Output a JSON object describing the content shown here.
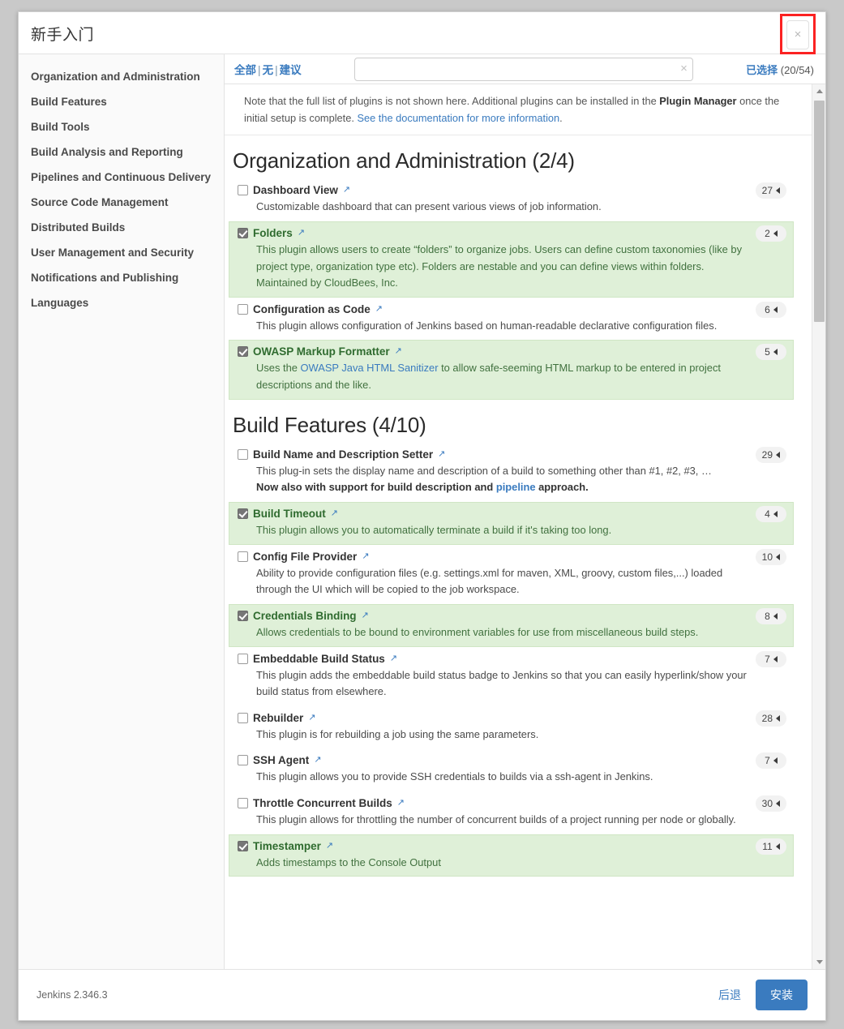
{
  "window": {
    "title": "新手入门",
    "close_label": "×"
  },
  "sidebar": {
    "items": [
      {
        "label": "Organization and Administration"
      },
      {
        "label": "Build Features"
      },
      {
        "label": "Build Tools"
      },
      {
        "label": "Build Analysis and Reporting"
      },
      {
        "label": "Pipelines and Continuous Delivery"
      },
      {
        "label": "Source Code Management"
      },
      {
        "label": "Distributed Builds"
      },
      {
        "label": "User Management and Security"
      },
      {
        "label": "Notifications and Publishing"
      },
      {
        "label": "Languages"
      }
    ]
  },
  "toolbar": {
    "filter_all": "全部",
    "filter_none": "无",
    "filter_suggested": "建议",
    "separator": "|",
    "search_value": "",
    "search_placeholder": "",
    "search_clear_icon": "×",
    "selected_label": "已选择",
    "selected_count": "(20/54)"
  },
  "notice": {
    "text_1": "Note that the full list of plugins is not shown here. Additional plugins can be installed in the ",
    "bold": "Plugin Manager",
    "text_2": " once the initial setup is complete. ",
    "link": "See the documentation for more information",
    "text_3": "."
  },
  "sections": [
    {
      "title": "Organization and Administration (2/4)",
      "plugins": [
        {
          "name": "Dashboard View",
          "checked": false,
          "badge": "27",
          "desc": "Customizable dashboard that can present various views of job information."
        },
        {
          "name": "Folders",
          "checked": true,
          "badge": "2",
          "desc": "This plugin allows users to create “folders” to organize jobs. Users can define custom taxonomies (like by project type, organization type etc). Folders are nestable and you can define views within folders. Maintained by CloudBees, Inc."
        },
        {
          "name": "Configuration as Code",
          "checked": false,
          "badge": "6",
          "desc": "This plugin allows configuration of Jenkins based on human-readable declarative configuration files."
        },
        {
          "name": "OWASP Markup Formatter",
          "checked": true,
          "badge": "5",
          "desc_pre": "Uses the ",
          "desc_link": "OWASP Java HTML Sanitizer",
          "desc_post": " to allow safe-seeming HTML markup to be entered in project descriptions and the like."
        }
      ]
    },
    {
      "title": "Build Features (4/10)",
      "plugins": [
        {
          "name": "Build Name and Description Setter",
          "checked": false,
          "badge": "29",
          "desc": "This plug-in sets the display name and description of a build to something other than #1, #2, #3, …",
          "desc_bold_pre": "Now also with support for build description and ",
          "desc_bold_link": "pipeline",
          "desc_bold_post": " approach."
        },
        {
          "name": "Build Timeout",
          "checked": true,
          "badge": "4",
          "desc": "This plugin allows you to automatically terminate a build if it's taking too long."
        },
        {
          "name": "Config File Provider",
          "checked": false,
          "badge": "10",
          "desc": "Ability to provide configuration files (e.g. settings.xml for maven, XML, groovy, custom files,...) loaded through the UI which will be copied to the job workspace."
        },
        {
          "name": "Credentials Binding",
          "checked": true,
          "badge": "8",
          "desc": "Allows credentials to be bound to environment variables for use from miscellaneous build steps."
        },
        {
          "name": "Embeddable Build Status",
          "checked": false,
          "badge": "7",
          "desc": "This plugin adds the embeddable build status badge to Jenkins so that you can easily hyperlink/show your build status from elsewhere."
        },
        {
          "name": "Rebuilder",
          "checked": false,
          "badge": "28",
          "desc": "This plugin is for rebuilding a job using the same parameters."
        },
        {
          "name": "SSH Agent",
          "checked": false,
          "badge": "7",
          "desc": "This plugin allows you to provide SSH credentials to builds via a ssh-agent in Jenkins."
        },
        {
          "name": "Throttle Concurrent Builds",
          "checked": false,
          "badge": "30",
          "desc": "This plugin allows for throttling the number of concurrent builds of a project running per node or globally."
        },
        {
          "name": "Timestamper",
          "checked": true,
          "badge": "11",
          "desc": "Adds timestamps to the Console Output"
        }
      ]
    }
  ],
  "footer": {
    "version": "Jenkins 2.346.3",
    "back_label": "后退",
    "install_label": "安装"
  },
  "colors": {
    "accent": "#3a7bbf",
    "selected_row_bg": "#dff0d8",
    "selected_text": "#2f6b2f",
    "highlight_box": "#fb2222"
  }
}
